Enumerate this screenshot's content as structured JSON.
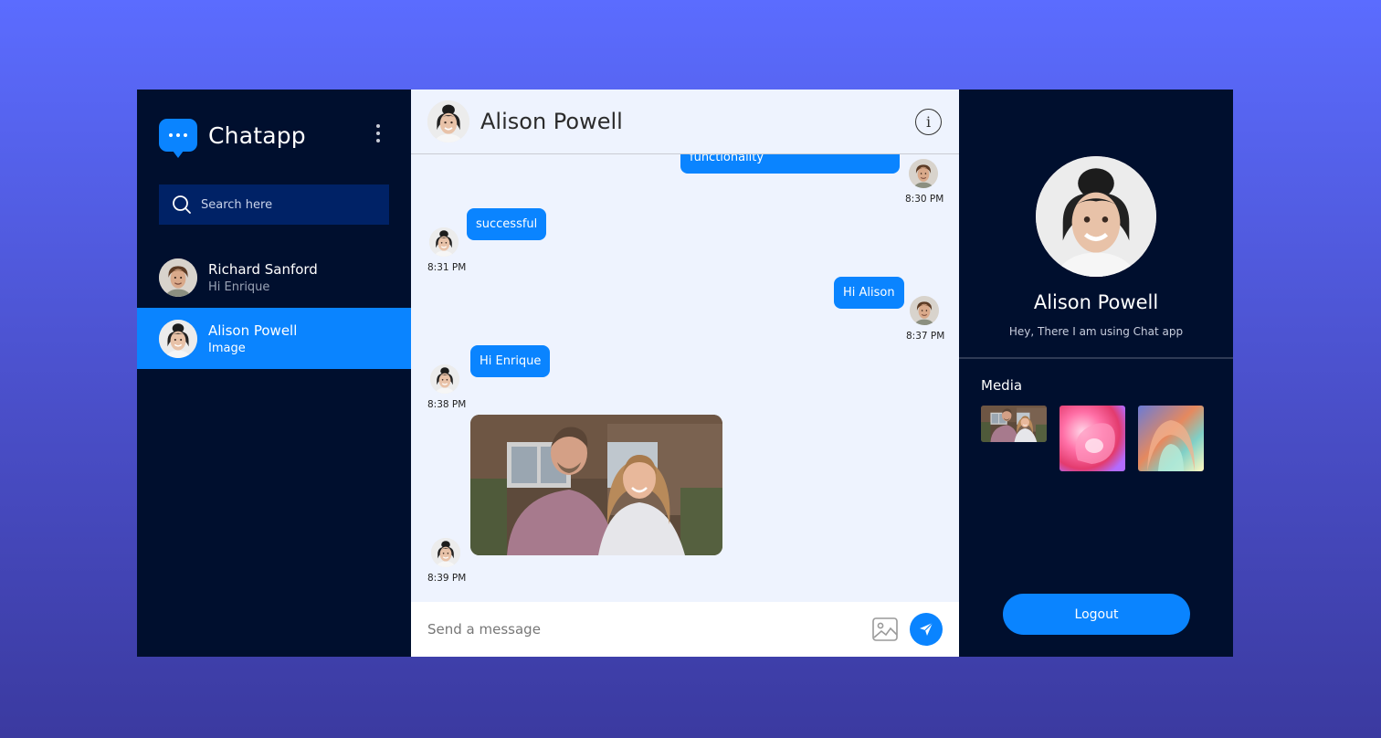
{
  "app": {
    "name": "Chatapp"
  },
  "search": {
    "placeholder": "Search here"
  },
  "contacts": [
    {
      "name": "Richard Sanford",
      "last_message": "Hi Enrique",
      "active": false
    },
    {
      "name": "Alison Powell",
      "last_message": "Image",
      "active": true
    }
  ],
  "chat": {
    "header_name": "Alison Powell",
    "messages": [
      {
        "sender": "me",
        "text": "functionality",
        "time": "8:30 PM"
      },
      {
        "sender": "them",
        "text": "successful",
        "time": "8:31 PM"
      },
      {
        "sender": "me",
        "text": "Hi Alison",
        "time": "8:37 PM"
      },
      {
        "sender": "them",
        "text": "Hi Enrique",
        "time": "8:38 PM"
      },
      {
        "sender": "them",
        "type": "image",
        "time": "8:39 PM"
      }
    ],
    "composer_placeholder": "Send a message"
  },
  "profile": {
    "name": "Alison Powell",
    "status": "Hey, There I am using Chat app",
    "media_title": "Media",
    "logout_label": "Logout"
  },
  "colors": {
    "accent": "#0a84ff",
    "panel": "#000f2e",
    "chat_bg": "#eef3fe"
  },
  "icons": [
    "chat-bubble-logo-icon",
    "kebab-menu-icon",
    "search-icon",
    "info-icon",
    "image-upload-icon",
    "send-icon"
  ]
}
